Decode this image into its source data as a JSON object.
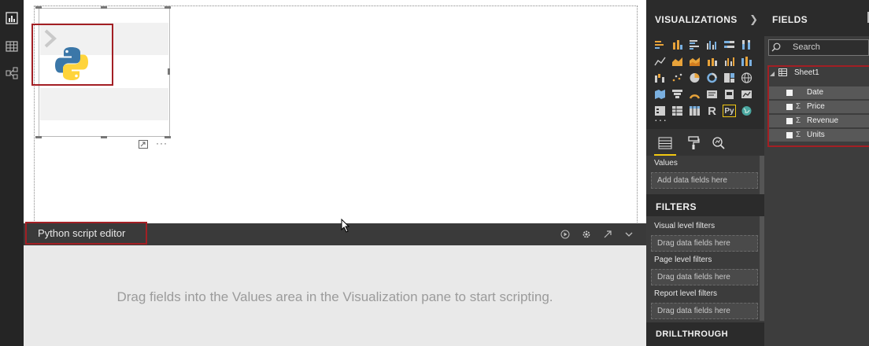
{
  "canvas": {
    "visual": {
      "icon": "python-logo-icon"
    }
  },
  "script_editor": {
    "title": "Python script editor",
    "hint": "Drag fields into the Values area in the Visualization pane to start scripting.",
    "icons": [
      "run-icon",
      "gear-icon",
      "expand-icon",
      "chevron-down-icon"
    ]
  },
  "visualizations": {
    "header": "VISUALIZATIONS",
    "r_label": "R",
    "py_label": "Py",
    "more": "···",
    "values_label": "Values",
    "values_drop": "Add data fields here",
    "filters_header": "FILTERS",
    "filters": [
      {
        "label": "Visual level filters",
        "drop": "Drag data fields here"
      },
      {
        "label": "Page level filters",
        "drop": "Drag data fields here"
      },
      {
        "label": "Report level filters",
        "drop": "Drag data fields here"
      }
    ],
    "drillthrough_header": "DRILLTHROUGH"
  },
  "fields": {
    "header": "FIELDS",
    "search_placeholder": "Search",
    "table_name": "Sheet1",
    "sigma": "Σ",
    "items": [
      {
        "name": "Date",
        "sigma": ""
      },
      {
        "name": "Price",
        "sigma": "Σ"
      },
      {
        "name": "Revenue",
        "sigma": "Σ"
      },
      {
        "name": "Units",
        "sigma": "Σ"
      }
    ]
  },
  "colors": {
    "highlight_red": "#a31f24",
    "accent_yellow": "#f2c811",
    "python_blue": "#3b77a8",
    "python_yellow": "#ffd43b"
  }
}
